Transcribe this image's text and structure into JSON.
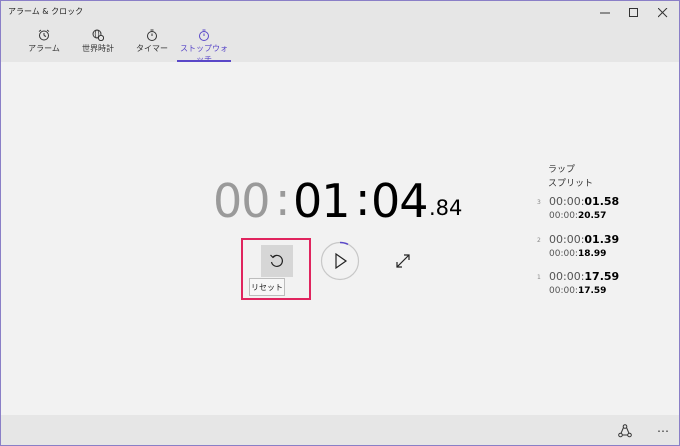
{
  "window": {
    "title": "アラーム & クロック"
  },
  "tabs": [
    {
      "label": "アラーム",
      "icon": "alarm-clock-icon"
    },
    {
      "label": "世界時計",
      "icon": "world-clock-icon"
    },
    {
      "label": "タイマー",
      "icon": "timer-icon"
    },
    {
      "label": "ストップウォッチ",
      "icon": "stopwatch-icon",
      "active": true
    }
  ],
  "stopwatch": {
    "hours": "00",
    "minutes": "01",
    "seconds": "04",
    "centiseconds": ".84"
  },
  "controls": {
    "reset_tooltip": "リセット"
  },
  "laps": {
    "header_lap": "ラップ",
    "header_split": "スプリット",
    "items": [
      {
        "index": "3",
        "lap_prefix": "00:00:",
        "lap_value": "01.58",
        "split_prefix": "00:00:",
        "split_value": "20.57"
      },
      {
        "index": "2",
        "lap_prefix": "00:00:",
        "lap_value": "01.39",
        "split_prefix": "00:00:",
        "split_value": "18.99"
      },
      {
        "index": "1",
        "lap_prefix": "00:00:",
        "lap_value": "17.59",
        "split_prefix": "00:00:",
        "split_value": "17.59"
      }
    ]
  },
  "colors": {
    "accent": "#5a48c8",
    "highlight": "#e0245e"
  }
}
